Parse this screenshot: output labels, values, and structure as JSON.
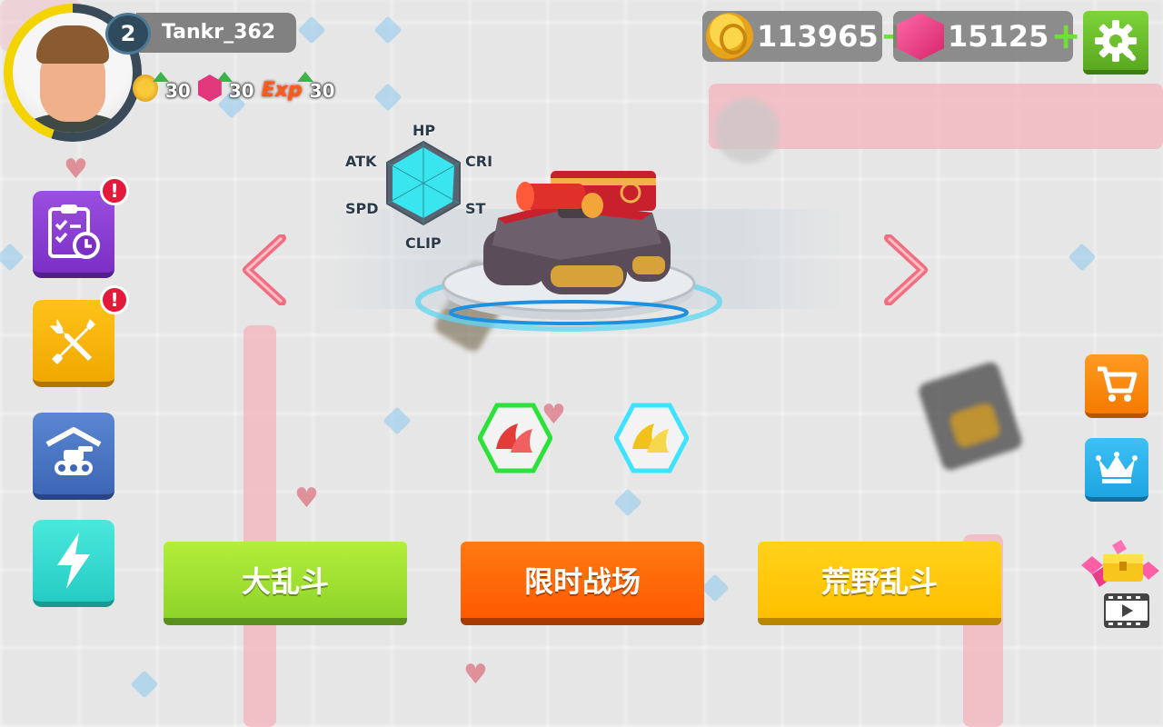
{
  "player": {
    "level": "2",
    "name": "Tankr_362",
    "avatar_icon": "player-avatar-portrait"
  },
  "boosts": [
    {
      "icon": "coin-boost-icon",
      "value": "30"
    },
    {
      "icon": "gem-boost-icon",
      "value": "30"
    },
    {
      "icon": "exp-boost-icon",
      "label": "Exp",
      "value": "30"
    }
  ],
  "currency": {
    "coins": "113965",
    "gems": "15125",
    "plus": "+"
  },
  "stats": {
    "labels": {
      "hp": "HP",
      "cri": "CRI",
      "st": "ST",
      "clip": "CLIP",
      "spd": "SPD",
      "atk": "ATK"
    }
  },
  "side_menu": {
    "tasks_alert": "!",
    "tools_alert": "!"
  },
  "modes": {
    "brawl": "大乱斗",
    "timed": "限时战场",
    "wild": "荒野乱斗"
  },
  "colors": {
    "accent_green": "#8ed42a",
    "accent_orange": "#ff5a00",
    "accent_yellow": "#ffc000",
    "tank_red": "#c8202c",
    "radar_fill": "#39e6f0"
  }
}
